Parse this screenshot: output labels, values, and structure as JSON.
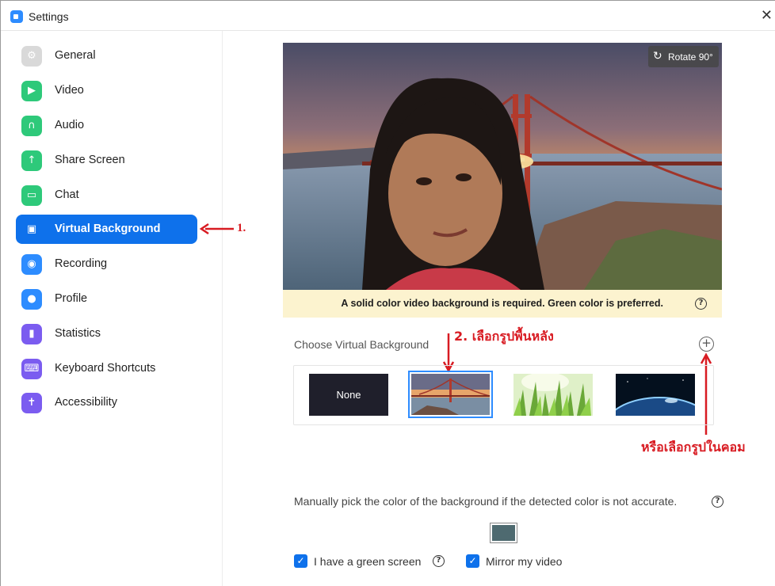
{
  "window": {
    "title": "Settings",
    "close_glyph": "✕"
  },
  "sidebar": {
    "items": [
      {
        "label": "General",
        "icon": "gear-icon",
        "color": "#d9d9d9"
      },
      {
        "label": "Video",
        "icon": "video-camera-icon",
        "color": "#2ec97a"
      },
      {
        "label": "Audio",
        "icon": "headphones-icon",
        "color": "#2ec97a"
      },
      {
        "label": "Share Screen",
        "icon": "share-screen-icon",
        "color": "#2ec97a"
      },
      {
        "label": "Chat",
        "icon": "chat-bubble-icon",
        "color": "#2ec97a"
      },
      {
        "label": "Virtual Background",
        "icon": "person-card-icon",
        "color": "#0e71eb",
        "active": true
      },
      {
        "label": "Recording",
        "icon": "record-icon",
        "color": "#2d8cff"
      },
      {
        "label": "Profile",
        "icon": "user-icon",
        "color": "#2d8cff"
      },
      {
        "label": "Statistics",
        "icon": "bar-chart-icon",
        "color": "#7b5cf0"
      },
      {
        "label": "Keyboard Shortcuts",
        "icon": "keyboard-icon",
        "color": "#7b5cf0"
      },
      {
        "label": "Accessibility",
        "icon": "accessibility-icon",
        "color": "#7b5cf0"
      }
    ]
  },
  "annotations": {
    "step1": "1.",
    "step2": "2. เลือกรูปพื้นหลัง",
    "step3": "หรือเลือกรูปในคอม",
    "color": "#d81b22"
  },
  "preview": {
    "rotate_label": "Rotate 90°",
    "notice": "A solid color video background is required. Green color is preferred."
  },
  "backgrounds": {
    "section_label": "Choose Virtual Background",
    "add_glyph": "+",
    "items": [
      {
        "label": "None"
      },
      {
        "label": "",
        "name": "golden-gate",
        "selected": true
      },
      {
        "label": "",
        "name": "grass"
      },
      {
        "label": "",
        "name": "earth-from-space"
      }
    ]
  },
  "color_pick": {
    "text": "Manually pick the color of the background if the detected color is not accurate.",
    "swatch_color": "#4e6a70"
  },
  "options": {
    "green_screen": {
      "label": "I have a green screen",
      "checked": true
    },
    "mirror": {
      "label": "Mirror my video",
      "checked": true
    }
  },
  "accent": "#0e71eb"
}
